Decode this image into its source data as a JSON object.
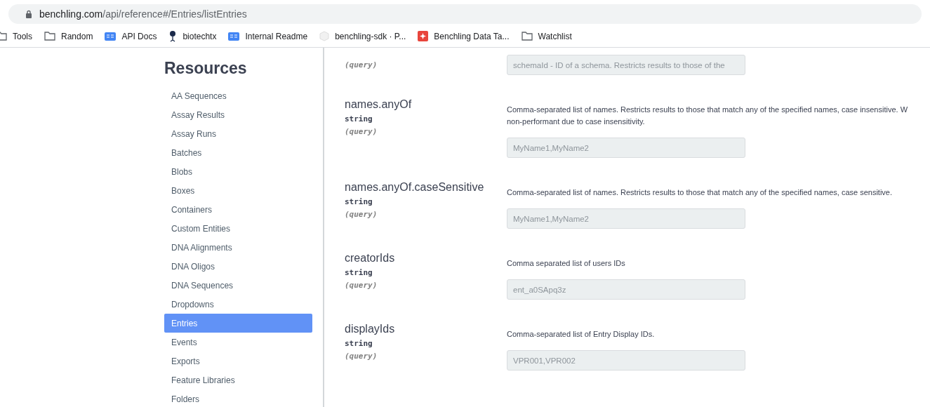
{
  "browser": {
    "url_host": "benchling.com",
    "url_path": "/api/reference#/Entries/listEntries"
  },
  "bookmarks": [
    {
      "label": "Tools",
      "kind": "folder"
    },
    {
      "label": "Random",
      "kind": "folder"
    },
    {
      "label": "API Docs",
      "kind": "book"
    },
    {
      "label": "biotechtx",
      "kind": "figure"
    },
    {
      "label": "Internal Readme",
      "kind": "book"
    },
    {
      "label": "benchling-sdk · P...",
      "kind": "cube"
    },
    {
      "label": "Benchling Data Ta...",
      "kind": "app"
    },
    {
      "label": "Watchlist",
      "kind": "folder"
    }
  ],
  "sidebar": {
    "title": "Resources",
    "items": [
      {
        "label": "AA Sequences",
        "selected": false
      },
      {
        "label": "Assay Results",
        "selected": false
      },
      {
        "label": "Assay Runs",
        "selected": false
      },
      {
        "label": "Batches",
        "selected": false
      },
      {
        "label": "Blobs",
        "selected": false
      },
      {
        "label": "Boxes",
        "selected": false
      },
      {
        "label": "Containers",
        "selected": false
      },
      {
        "label": "Custom Entities",
        "selected": false
      },
      {
        "label": "DNA Alignments",
        "selected": false
      },
      {
        "label": "DNA Oligos",
        "selected": false
      },
      {
        "label": "DNA Sequences",
        "selected": false
      },
      {
        "label": "Dropdowns",
        "selected": false
      },
      {
        "label": "Entries",
        "selected": true
      },
      {
        "label": "Events",
        "selected": false
      },
      {
        "label": "Exports",
        "selected": false
      },
      {
        "label": "Feature Libraries",
        "selected": false
      },
      {
        "label": "Folders",
        "selected": false
      }
    ]
  },
  "parameters": [
    {
      "location": "(query)",
      "placeholder": "schemaId - ID of a schema. Restricts results to those of the"
    },
    {
      "name": "names.anyOf",
      "type": "string",
      "location": "(query)",
      "description": [
        "Comma-separated list of names. Restricts results to those that match any of the specified names, case insensitive. W",
        "non-performant due to case insensitivity."
      ],
      "placeholder": "MyName1,MyName2"
    },
    {
      "name": "names.anyOf.caseSensitive",
      "type": "string",
      "location": "(query)",
      "description": [
        "Comma-separated list of names. Restricts results to those that match any of the specified names, case sensitive."
      ],
      "placeholder": "MyName1,MyName2"
    },
    {
      "name": "creatorIds",
      "type": "string",
      "location": "(query)",
      "description": [
        "Comma separated list of users IDs"
      ],
      "placeholder": "ent_a0SApq3z"
    },
    {
      "name": "displayIds",
      "type": "string",
      "location": "(query)",
      "description": [
        "Comma-separated list of Entry Display IDs."
      ],
      "placeholder": "VPR001,VPR002"
    }
  ]
}
